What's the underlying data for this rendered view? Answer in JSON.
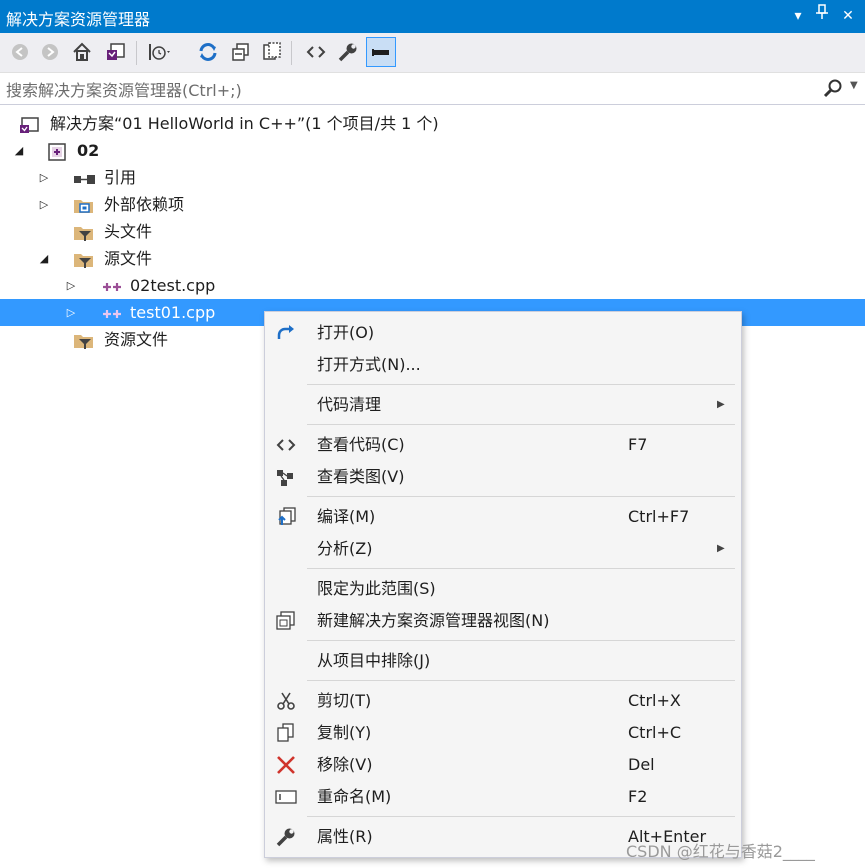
{
  "window": {
    "title": "解决方案资源管理器",
    "dropdown_glyph": "▾",
    "pin_glyph": "⊥",
    "close_glyph": "✕",
    "accent": "#007acc"
  },
  "toolbar": {
    "buttons": [
      "back-icon",
      "forward-icon",
      "home-icon",
      "switch-views-icon",
      "pending-changes-filter-icon",
      "sync-icon",
      "collapse-all-icon",
      "show-all-files-icon",
      "view-code-icon",
      "properties-icon",
      "preview-selected-icon"
    ]
  },
  "search": {
    "placeholder": "搜索解决方案资源管理器(Ctrl+;)"
  },
  "tree": {
    "solution": "解决方案“01 HelloWorld in C++”(1 个项目/共 1 个)",
    "project": "02",
    "references": "引用",
    "external_deps": "外部依赖项",
    "headers": "头文件",
    "sources": "源文件",
    "file1": "02test.cpp",
    "file2": "test01.cpp",
    "resources": "资源文件",
    "selection_color": "#3399ff"
  },
  "context_menu": {
    "open": "打开(O)",
    "open_with": "打开方式(N)...",
    "code_cleanup": "代码清理",
    "view_code": "查看代码(C)",
    "view_code_key": "F7",
    "view_class_diagram": "查看类图(V)",
    "compile": "编译(M)",
    "compile_key": "Ctrl+F7",
    "analyze": "分析(Z)",
    "scope_to_this": "限定为此范围(S)",
    "new_view": "新建解决方案资源管理器视图(N)",
    "exclude": "从项目中排除(J)",
    "cut": "剪切(T)",
    "cut_key": "Ctrl+X",
    "copy": "复制(Y)",
    "copy_key": "Ctrl+C",
    "remove": "移除(V)",
    "remove_key": "Del",
    "rename": "重命名(M)",
    "rename_key": "F2",
    "properties": "属性(R)",
    "properties_key": "Alt+Enter",
    "submenu_arrow": "▶"
  },
  "watermark": "CSDN @红花与香菇2____"
}
